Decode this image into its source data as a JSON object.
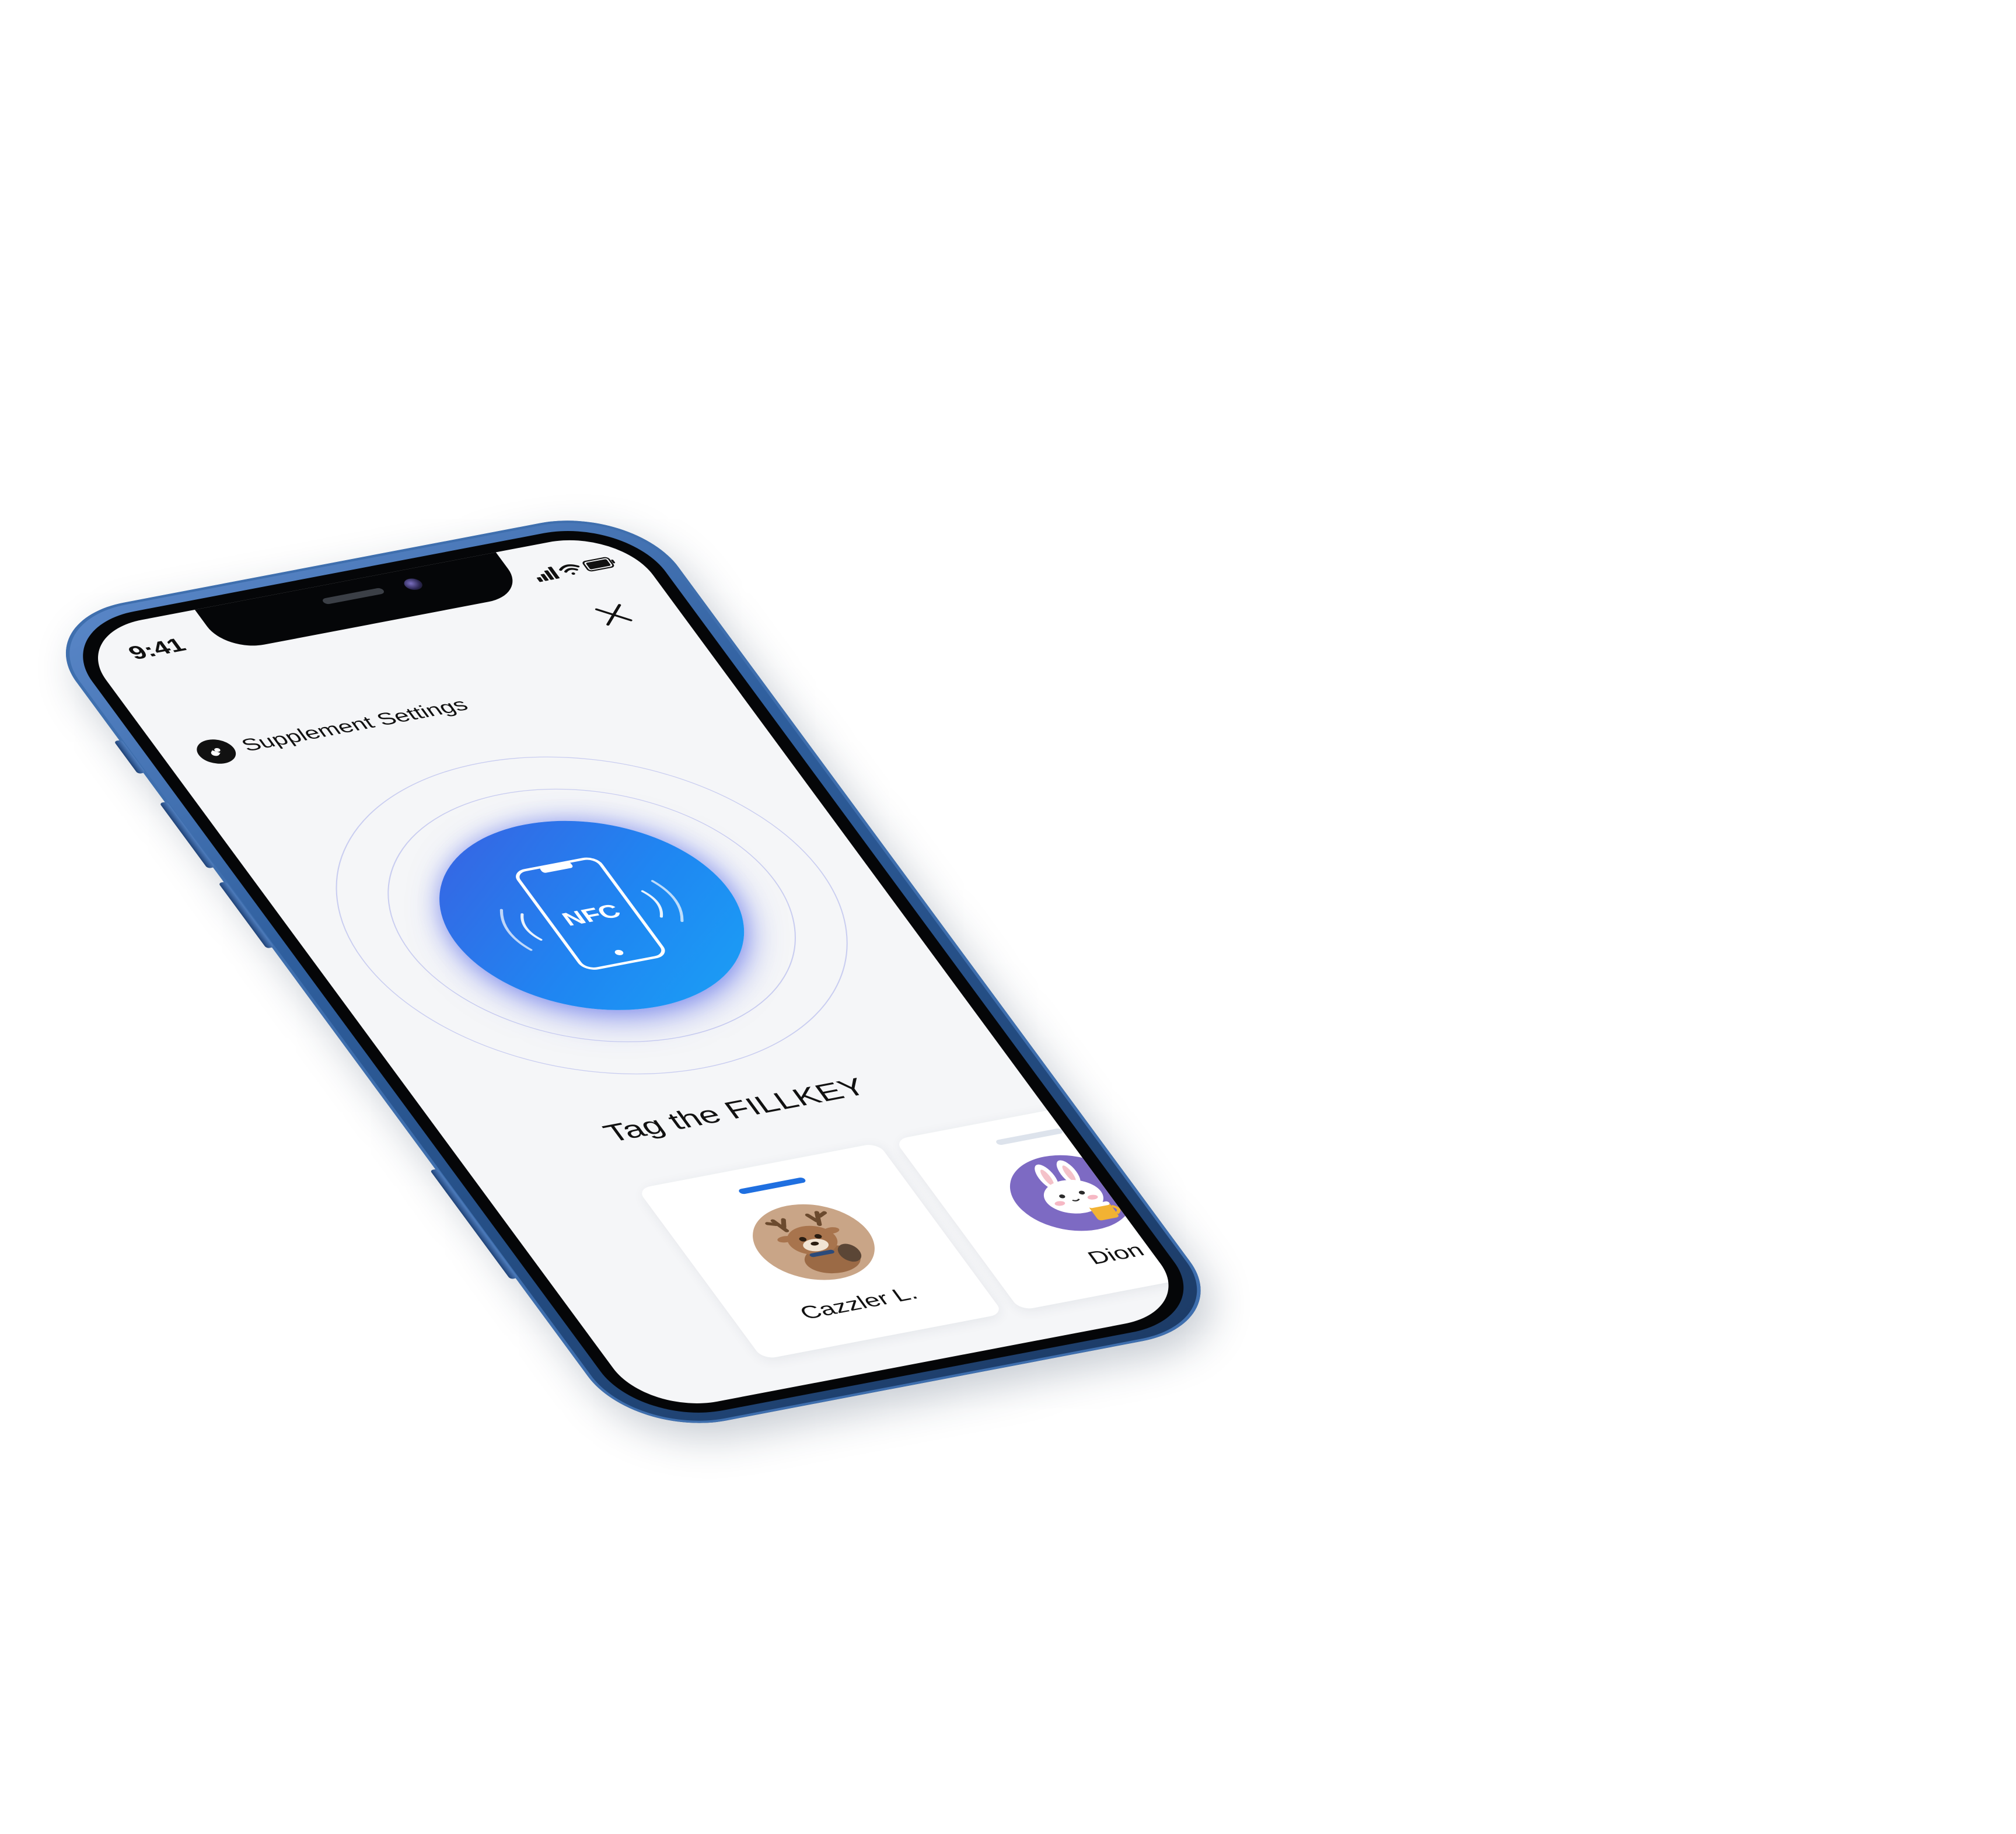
{
  "status_bar": {
    "time": "9:41",
    "icons": [
      "cellular-signal-icon",
      "wifi-icon",
      "battery-icon"
    ]
  },
  "header": {
    "icon": "capsule-icon",
    "title": "Supplement Settings",
    "close_icon": "close-icon"
  },
  "nfc": {
    "label": "NFC",
    "icon": "phone-nfc-icon"
  },
  "prompt": {
    "title": "Tag the FILLKEY"
  },
  "profiles": [
    {
      "name": "Cazzler L.",
      "avatar": "deer-avatar-icon",
      "selected": true,
      "indicator_color": "#1f6fe0",
      "avatar_bg": "#c9a587"
    },
    {
      "name": "Dion",
      "avatar": "rabbit-avatar-icon",
      "selected": false,
      "indicator_color": "#dde3ec",
      "avatar_bg": "#7d6ac3"
    }
  ],
  "colors": {
    "frame": "#2f5f9e",
    "screen_bg": "#f5f6f8",
    "accent": "#1f86f2",
    "text": "#111111"
  }
}
